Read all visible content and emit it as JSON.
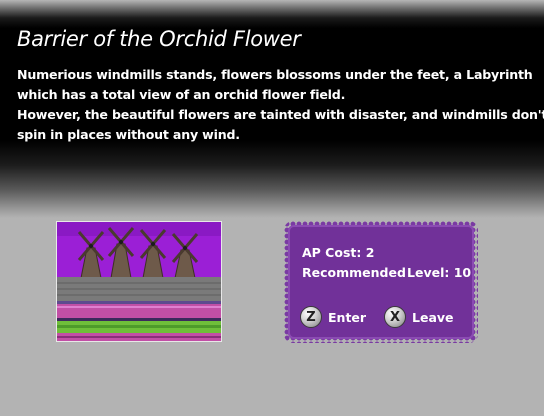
{
  "dungeon": {
    "title": "Barrier of the Orchid Flower",
    "description_lines": [
      "Numerious windmills stands, flowers blossoms under the feet, a Labyrinth",
      "which has a total view of an orchid flower field.",
      "However, the beautiful flowers are tainted with disaster, and windmills don't",
      "spin in places without any wind."
    ]
  },
  "info": {
    "ap_cost": "AP Cost: 2",
    "recommended_label": "Recommended",
    "level": "Level: 10"
  },
  "buttons": {
    "enter": {
      "key": "Z",
      "label": "Enter",
      "icon": "z-key-icon"
    },
    "leave": {
      "key": "X",
      "label": "Leave",
      "icon": "x-key-icon"
    }
  },
  "colors": {
    "panel": "#713199",
    "sky": "#9b1fd6",
    "banner": "#000000",
    "background": "#b3b3b3"
  }
}
